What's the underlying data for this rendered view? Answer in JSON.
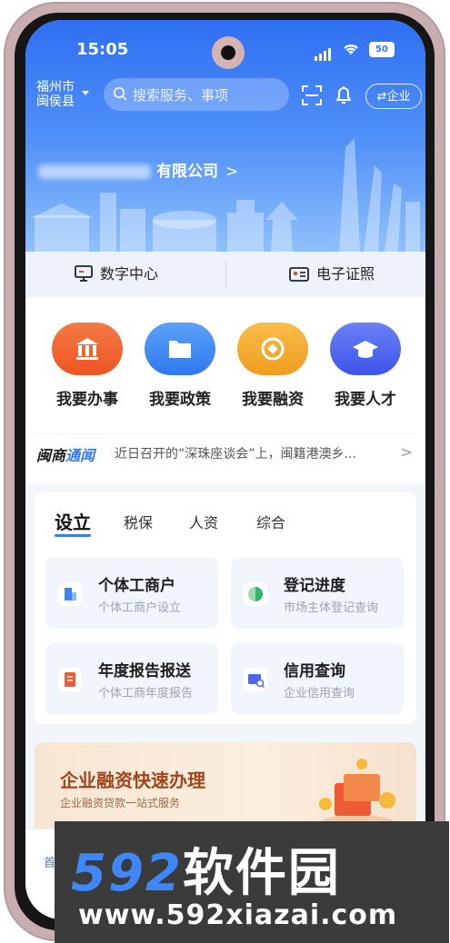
{
  "status_bar": {
    "time": "15:05",
    "battery": "50"
  },
  "header": {
    "location_line1": "福州市",
    "location_line2": "闽侯县",
    "search_placeholder": "搜索服务、事项",
    "switch_label": "⇄企业",
    "company_suffix": "有限公司",
    "company_chevron": ">"
  },
  "quick_links": [
    {
      "label": "数字中心",
      "icon": "monitor-icon"
    },
    {
      "label": "电子证照",
      "icon": "id-card-icon"
    }
  ],
  "services": [
    {
      "label": "我要办事",
      "icon": "government-building-icon",
      "color": "#f0622d"
    },
    {
      "label": "我要政策",
      "icon": "folder-icon",
      "color": "#3b84f2"
    },
    {
      "label": "我要融资",
      "icon": "coin-icon",
      "color": "#f4a92b"
    },
    {
      "label": "我要人才",
      "icon": "graduation-cap-icon",
      "color": "#4e66ee"
    }
  ],
  "news": {
    "brand_a": "闽商",
    "brand_b": "通闻",
    "text": "近日召开的“深珠座谈会”上，闽籍港澳乡...",
    "chevron": ">"
  },
  "business_tabs": [
    {
      "label": "设立",
      "active": true
    },
    {
      "label": "税保",
      "active": false
    },
    {
      "label": "人资",
      "active": false
    },
    {
      "label": "综合",
      "active": false
    }
  ],
  "business_tiles": [
    {
      "title": "个体工商户",
      "subtitle": "个体工商户设立",
      "icon": "building-icon",
      "color": "#3b84f2"
    },
    {
      "title": "登记进度",
      "subtitle": "市场主体登记查询",
      "icon": "progress-pie-icon",
      "color": "#36b36b"
    },
    {
      "title": "年度报告报送",
      "subtitle": "个体工商年度报告",
      "icon": "report-icon",
      "color": "#ee5b3a"
    },
    {
      "title": "信用查询",
      "subtitle": "企业信用查询",
      "icon": "credit-search-icon",
      "color": "#4e66ee"
    }
  ],
  "banner": {
    "title": "企业融资快速办理",
    "subtitle": "企业融资贷款一站式服务"
  },
  "bottom_nav": {
    "home_label": "首"
  },
  "watermark": {
    "line1_num": "592",
    "line1_text": "软件园",
    "line2": "www.592xiazai.com"
  },
  "colors": {
    "primary": "#3a78f0",
    "hero_top": "#2f6ff2",
    "hero_bottom": "#8ec0fb"
  }
}
